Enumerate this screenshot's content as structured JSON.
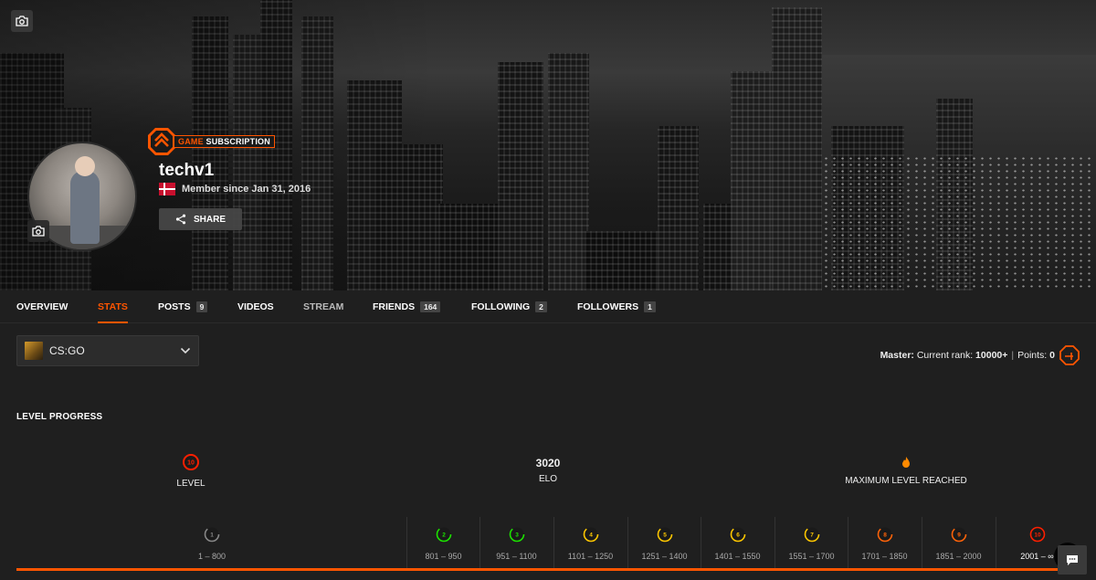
{
  "profile": {
    "badge_prefix": "GAME",
    "badge_suffix": "SUBSCRIPTION",
    "username": "techv1",
    "member_since": "Member since Jan 31, 2016",
    "share_label": "SHARE"
  },
  "nav": {
    "items": [
      {
        "label": "OVERVIEW"
      },
      {
        "label": "STATS"
      },
      {
        "label": "POSTS",
        "count": "9"
      },
      {
        "label": "VIDEOS"
      },
      {
        "label": "STREAM"
      },
      {
        "label": "FRIENDS",
        "count": "164"
      },
      {
        "label": "FOLLOWING",
        "count": "2"
      },
      {
        "label": "FOLLOWERS",
        "count": "1"
      }
    ],
    "active": "STATS"
  },
  "game_select": {
    "value": "CS:GO"
  },
  "rank": {
    "prefix": "Master:",
    "text": "Current rank:",
    "rank_value": "10000+",
    "points_label": "Points:",
    "points_value": "0"
  },
  "level_progress": {
    "title": "LEVEL PROGRESS",
    "level_value": "10",
    "level_label": "LEVEL",
    "elo_value": "3020",
    "elo_label": "ELO",
    "max_label": "MAXIMUM LEVEL REACHED",
    "progress_fraction": 1.0,
    "levels": [
      {
        "n": "1",
        "range": "1 – 800",
        "color": "#888888"
      },
      {
        "n": "2",
        "range": "801 – 950",
        "color": "#1ce400"
      },
      {
        "n": "3",
        "range": "951 – 1100",
        "color": "#1ce400"
      },
      {
        "n": "4",
        "range": "1101 – 1250",
        "color": "#ffc800"
      },
      {
        "n": "5",
        "range": "1251 – 1400",
        "color": "#ffc800"
      },
      {
        "n": "6",
        "range": "1401 – 1550",
        "color": "#ffc800"
      },
      {
        "n": "7",
        "range": "1551 – 1700",
        "color": "#ffc800"
      },
      {
        "n": "8",
        "range": "1701 – 1850",
        "color": "#ff6309"
      },
      {
        "n": "9",
        "range": "1851 – 2000",
        "color": "#ff6309"
      },
      {
        "n": "10",
        "range": "2001 – ∞",
        "color": "#fe1f00"
      }
    ]
  },
  "colors": {
    "accent": "#ff5500",
    "background": "#1f1f1f"
  }
}
